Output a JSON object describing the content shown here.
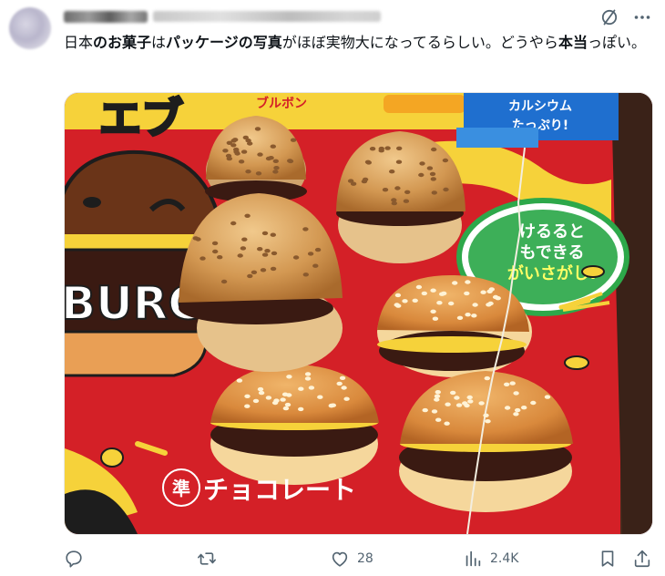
{
  "tweet": {
    "text_segments": [
      {
        "text": "日本",
        "bold": false
      },
      {
        "text": "のお菓子",
        "bold": true
      },
      {
        "text": "は",
        "bold": false
      },
      {
        "text": "パッケージの写真",
        "bold": true
      },
      {
        "text": "がほぼ実物大になってるらしい。どうやら",
        "bold": false
      },
      {
        "text": "本当",
        "bold": true
      },
      {
        "text": "っぽい。",
        "bold": false
      }
    ]
  },
  "media": {
    "package_text": {
      "title_partial": "エブ",
      "brand_partial": "ブルボン",
      "calcium_line1": "カルシウム",
      "calcium_line2": "たっぷり!",
      "bubble_line1": "けるると",
      "bubble_line2": "もできる",
      "bubble_line3": "がいさがし!",
      "burger_word": "BURG",
      "bottom_label": "チョコレート",
      "seal_char": "準"
    },
    "colors": {
      "box_red": "#d42027",
      "bun": "#d79a52",
      "chocolate": "#3a1a12",
      "cookie": "#e6c28b",
      "blue_panel": "#1f6fcf"
    }
  },
  "actions": {
    "reply_count": "",
    "retweet_count": "",
    "like_count": "28",
    "views_count": "2.4K"
  },
  "icons": {
    "grok": "grok-slash-icon",
    "more": "more-dots-icon",
    "reply": "reply-bubble-icon",
    "retweet": "retweet-arrows-icon",
    "like": "heart-icon",
    "views": "bar-chart-icon",
    "bookmark": "bookmark-icon",
    "share": "share-upload-icon"
  }
}
